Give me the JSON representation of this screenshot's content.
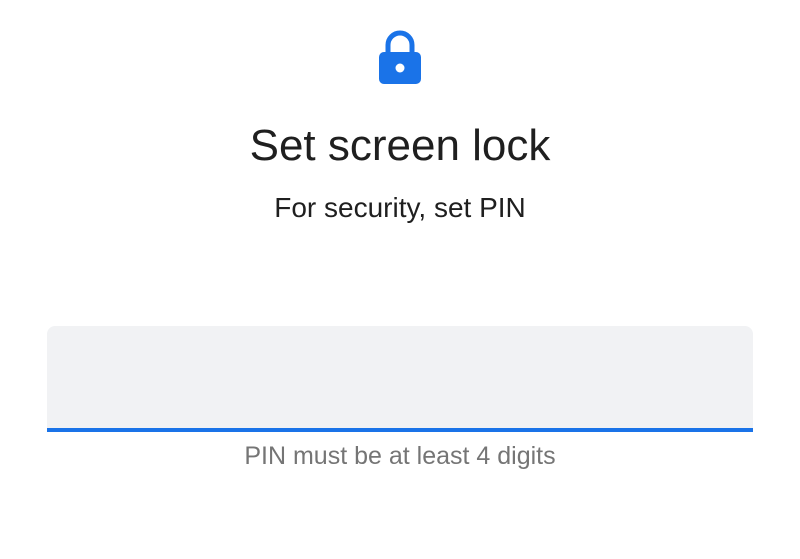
{
  "header": {
    "icon": "lock-icon",
    "title": "Set screen lock",
    "subtitle": "For security, set PIN"
  },
  "pin_field": {
    "value": "",
    "placeholder": ""
  },
  "helper_text": "PIN must be at least 4 digits",
  "colors": {
    "accent": "#1a73e8",
    "field_background": "#f1f2f4",
    "title_text": "#1f1f1f",
    "helper_text": "#757575"
  }
}
